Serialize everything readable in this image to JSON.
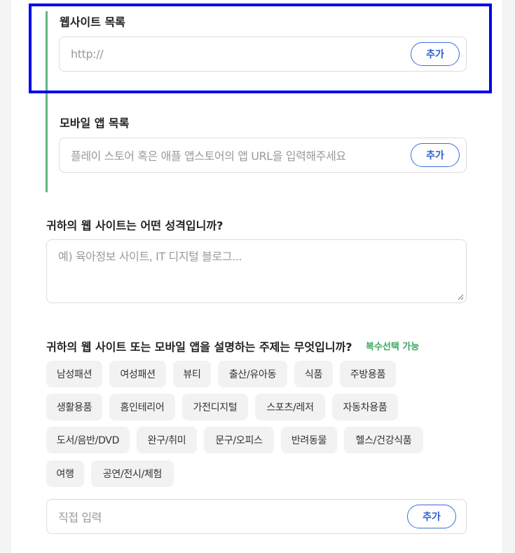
{
  "sections": {
    "website_list": {
      "label": "웹사이트 목록",
      "placeholder": "http://",
      "add_label": "추가"
    },
    "mobile_app_list": {
      "label": "모바일 앱 목록",
      "placeholder": "플레이 스토어 혹은 애플 앱스토어의 앱 URL을 입력해주세요",
      "add_label": "추가"
    },
    "site_nature": {
      "question": "귀하의 웹 사이트는 어떤 성격입니까?",
      "placeholder": "예) 육아정보 사이트, IT 디지털 블로그..."
    },
    "topics": {
      "question": "귀하의 웹 사이트 또는 모바일 앱을 설명하는 주제는 무엇입니까?",
      "multi_select_note": "복수선택 가능",
      "chips": [
        "남성패션",
        "여성패션",
        "뷰티",
        "출산/유아동",
        "식품",
        "주방용품",
        "생활용품",
        "홈인테리어",
        "가전디지털",
        "스포츠/레저",
        "자동차용품",
        "도서/음반/DVD",
        "완구/취미",
        "문구/오피스",
        "반려동물",
        "헬스/건강식품",
        "여행",
        "공연/전시/체험"
      ],
      "custom_placeholder": "직접 입력",
      "add_label": "추가"
    }
  },
  "colors": {
    "accent_blue": "#2c5fcf",
    "green_bar": "#63b57e",
    "multi_green": "#3aa65c",
    "highlight": "#0000ee"
  }
}
